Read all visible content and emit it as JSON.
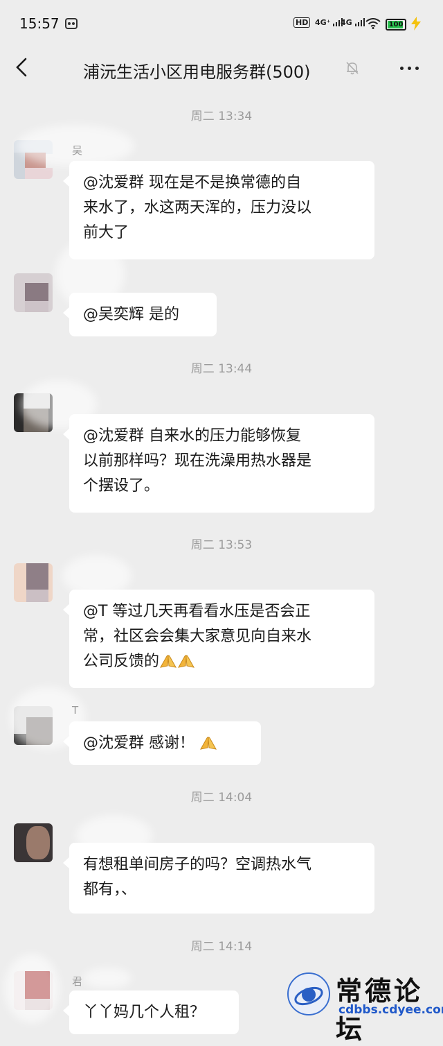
{
  "status_bar": {
    "time": "15:57",
    "hd": "HD",
    "sig1": "4G⁺",
    "sig2": "4G",
    "battery": "100",
    "battery_level": 1.0
  },
  "header": {
    "title": "浦沅生活小区用电服务群(500)",
    "back_icon": "chevron-left-icon",
    "mute_icon": "bell-off-icon",
    "more_icon": "more-horizontal-icon"
  },
  "timestamps": [
    "周二 13:34",
    "周二 13:44",
    "周二 13:53",
    "周二 14:04",
    "周二 14:14"
  ],
  "messages": [
    {
      "name": "吴",
      "text1": "@沈爱群  现在是不是换常德的自",
      "text2": "来水了，水这两天浑的，压力没以",
      "text3": "前大了"
    },
    {
      "name": "",
      "text1": "@吴奕辉  是的"
    },
    {
      "name": "",
      "text1": "@沈爱群  自来水的压力能够恢复",
      "text2": "以前那样吗？现在洗澡用热水器是",
      "text3": "个摆设了。"
    },
    {
      "name": "",
      "text1": "@T  等过几天再看看水压是否会正",
      "text2": "常，社区会会集大家意见向自来水",
      "text3": "公司反馈的"
    },
    {
      "name": "T",
      "text1": "@沈爱群  感谢！"
    },
    {
      "name": "",
      "text1": "有想租单间房子的吗？空调热水气",
      "text2": "都有，、"
    },
    {
      "name": "君",
      "text1": "丫丫妈几个人租？"
    }
  ],
  "watermark": {
    "title": "常德论坛",
    "url": "cdbbs.cdyee.com"
  }
}
